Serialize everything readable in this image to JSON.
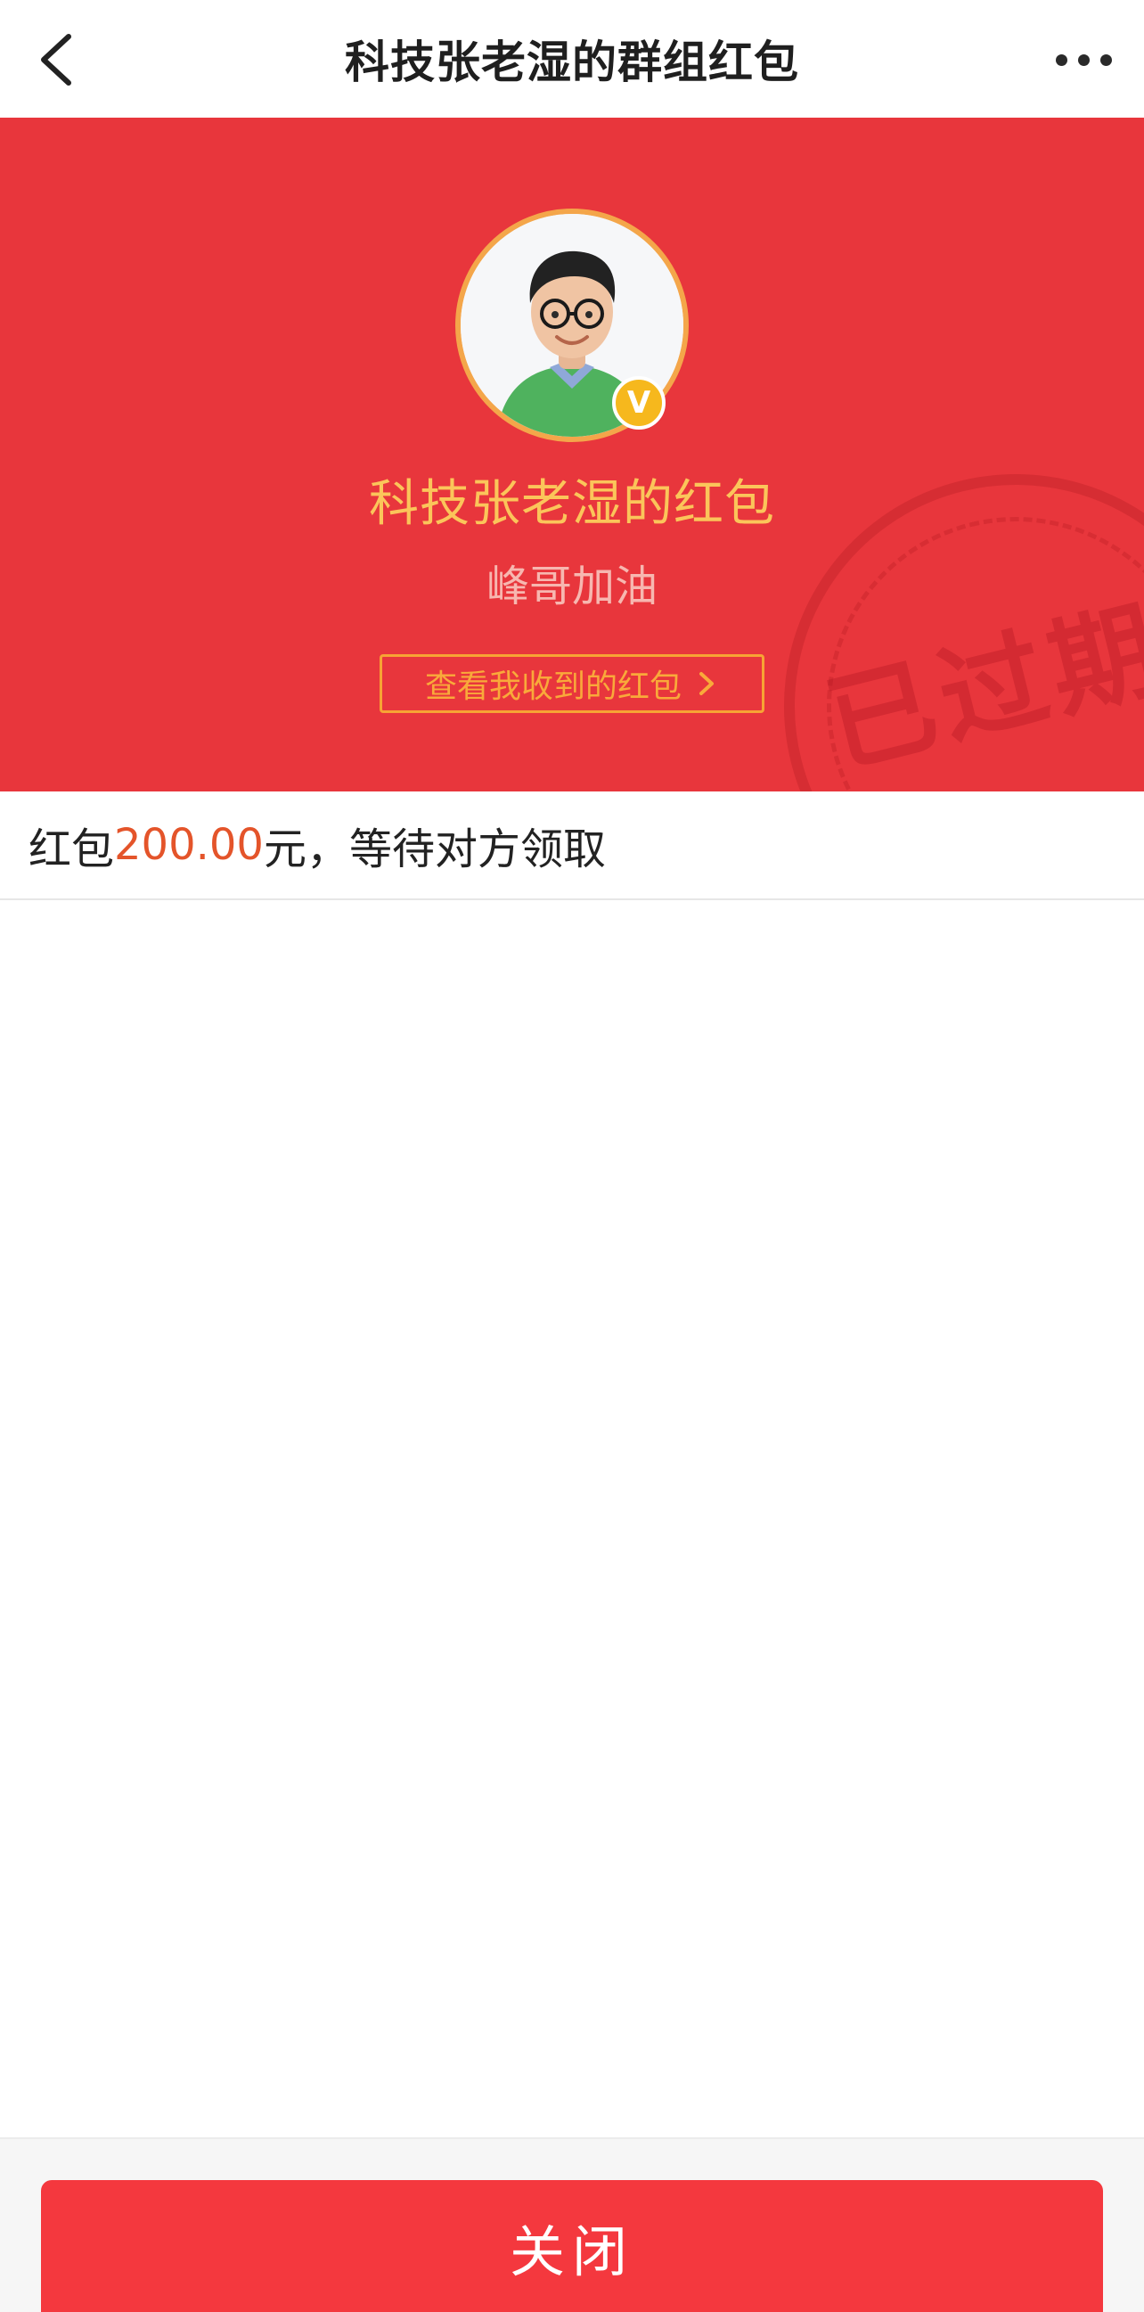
{
  "nav": {
    "title": "科技张老湿的群组红包",
    "back_icon": "chevron-left-icon",
    "more_icon": "more-dots-icon"
  },
  "header": {
    "sender_name": "科技张老湿的红包",
    "greeting": "峰哥加油",
    "view_received_label": "查看我收到的红包",
    "vip_badge": "V",
    "stamp_text": "已过期",
    "colors": {
      "background": "#e8363c",
      "name": "#fbc55a",
      "link": "#f9a93a"
    }
  },
  "status": {
    "prefix": "红包",
    "amount": "200.00",
    "suffix": "元，等待对方领取",
    "amount_color": "#e4542a"
  },
  "footer": {
    "close_label": "关闭",
    "button_color": "#f4383e"
  }
}
